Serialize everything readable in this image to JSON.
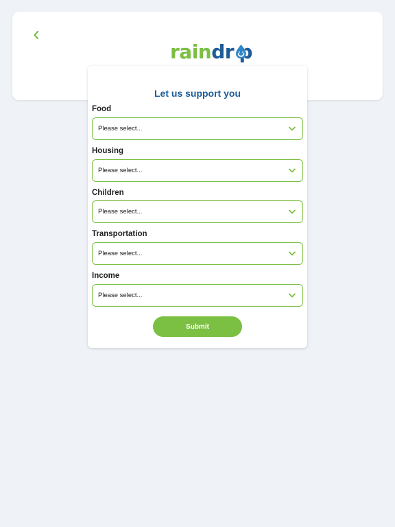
{
  "brand": {
    "logo_part1": "rain",
    "logo_part2": "dr",
    "logo_part3": "p",
    "green": "#7bbf43",
    "blue": "#1e5d98"
  },
  "nav": {
    "back_icon": "chevron-left-icon"
  },
  "form": {
    "title": "Let us support you",
    "fields": [
      {
        "label": "Food",
        "value": "Please select..."
      },
      {
        "label": "Housing",
        "value": "Please select..."
      },
      {
        "label": "Children",
        "value": "Please select..."
      },
      {
        "label": "Transportation",
        "value": "Please select..."
      },
      {
        "label": "Income",
        "value": "Please select..."
      }
    ],
    "dropdown_icon": "chevron-down-icon",
    "submit_label": "Submit"
  }
}
